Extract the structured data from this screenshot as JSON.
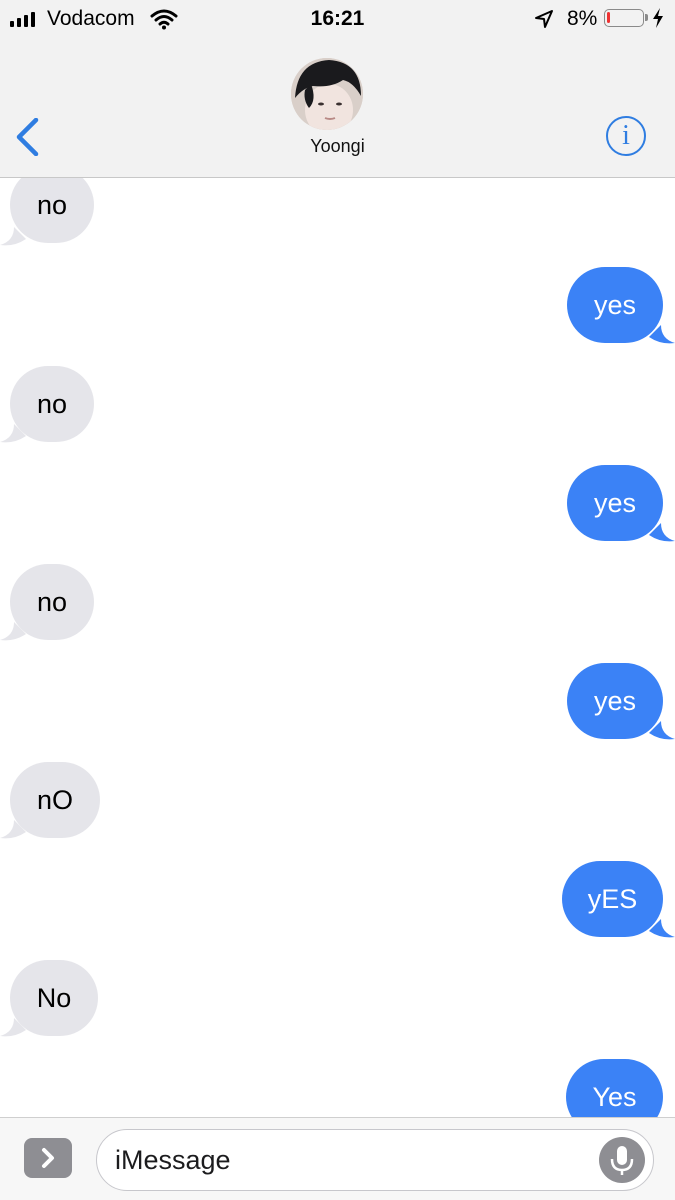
{
  "status_bar": {
    "carrier": "Vodacom",
    "time": "16:21",
    "battery_percent_label": "8%",
    "battery_level": 0.08
  },
  "contact": {
    "name": "Yoongi"
  },
  "messages": [
    {
      "dir": "in",
      "text": "no"
    },
    {
      "dir": "out",
      "text": "yes"
    },
    {
      "dir": "in",
      "text": "no"
    },
    {
      "dir": "out",
      "text": "yes"
    },
    {
      "dir": "in",
      "text": "no"
    },
    {
      "dir": "out",
      "text": "yes"
    },
    {
      "dir": "in",
      "text": "nO"
    },
    {
      "dir": "out",
      "text": "yES"
    },
    {
      "dir": "in",
      "text": "No"
    },
    {
      "dir": "out",
      "text": "Yes"
    }
  ],
  "input": {
    "placeholder": "iMessage"
  },
  "colors": {
    "incoming_bubble": "#e5e5ea",
    "outgoing_bubble": "#3b82f6",
    "accent": "#2f7de1"
  }
}
